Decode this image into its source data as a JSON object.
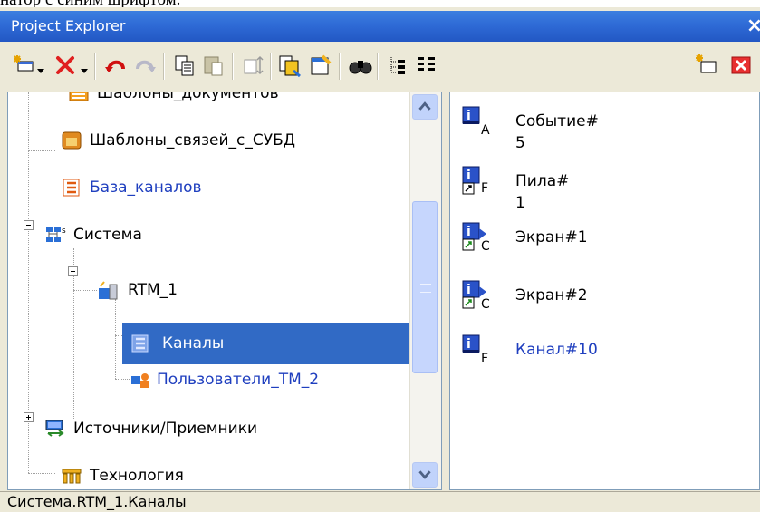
{
  "caption_fragment": "натор с синим шрифтом.",
  "window": {
    "title": "Project Explorer",
    "close_glyph": "×"
  },
  "toolbar": {
    "buttons": [
      {
        "name": "new-item-icon"
      },
      {
        "name": "delete-icon"
      },
      {
        "name": "undo-icon"
      },
      {
        "name": "redo-icon"
      },
      {
        "name": "copy-icon"
      },
      {
        "name": "paste-icon"
      },
      {
        "name": "sort-icon"
      },
      {
        "name": "copy-template-icon"
      },
      {
        "name": "properties-icon"
      },
      {
        "name": "find-icon"
      },
      {
        "name": "tree-view-icon"
      },
      {
        "name": "list-view-icon"
      },
      {
        "name": "new-window-icon"
      },
      {
        "name": "close-window-icon"
      }
    ]
  },
  "tree": {
    "items": [
      {
        "label": "Шаблоны_документов",
        "style": "normal"
      },
      {
        "label": "Шаблоны_связей_с_СУБД",
        "style": "normal"
      },
      {
        "label": "База_каналов",
        "style": "blue"
      },
      {
        "label": "Система",
        "style": "normal",
        "expander": "minus"
      },
      {
        "label": "RTM_1",
        "style": "normal",
        "expander": "minus"
      },
      {
        "label": "Каналы",
        "style": "selected"
      },
      {
        "label": "Пользователи_ТМ_2",
        "style": "blue"
      },
      {
        "label": "Источники/Приемники",
        "style": "normal",
        "expander": "plus"
      },
      {
        "label": "Технология",
        "style": "normal"
      }
    ]
  },
  "list": {
    "items": [
      {
        "label": "Событие# 5",
        "subscript": "A",
        "style": "normal"
      },
      {
        "label": "Пила# 1",
        "subscript": "F",
        "style": "normal"
      },
      {
        "label": "Экран#1",
        "subscript": "C",
        "style": "normal"
      },
      {
        "label": "Экран#2",
        "subscript": "C",
        "style": "normal"
      },
      {
        "label": "Канал#10",
        "subscript": "F",
        "style": "blue"
      }
    ]
  },
  "status": {
    "path": "Система.RTM_1.Каналы"
  },
  "colors": {
    "title_bar": "#2f6bd6",
    "selection": "#316ac5",
    "link_blue": "#1f3fbf",
    "delete_red": "#e02020"
  }
}
